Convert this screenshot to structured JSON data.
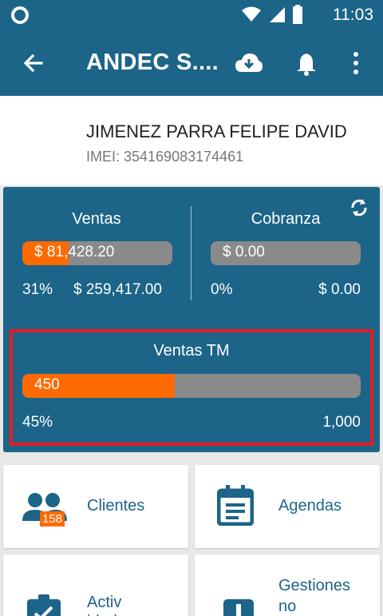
{
  "status_bar": {
    "time": "11:03"
  },
  "app_bar": {
    "title": "ANDEC S...."
  },
  "user": {
    "name": "JIMENEZ PARRA FELIPE DAVID",
    "imei": "IMEI: 354169083174461"
  },
  "ventas": {
    "title": "Ventas",
    "bar_label": "$ 81,428.20",
    "percent": "31%",
    "total": "$ 259,417.00",
    "progress": 0.31
  },
  "cobranza": {
    "title": "Cobranza",
    "bar_label": "$ 0.00",
    "percent": "0%",
    "total": "$ 0.00",
    "progress": 0.0
  },
  "ventas_tm": {
    "title": "Ventas TM",
    "bar_label": "450",
    "percent": "45%",
    "total": "1,000",
    "progress": 0.45
  },
  "tiles": {
    "clientes": {
      "label": "Clientes",
      "badge": "158"
    },
    "agendas": {
      "label": "Agendas"
    },
    "actividades": {
      "label": "Activ\nidades"
    },
    "gestiones": {
      "label": "Gestiones\nno"
    }
  },
  "colors": {
    "primary": "#1c6488",
    "accent": "#ff6a00",
    "highlight": "#e21f26"
  }
}
